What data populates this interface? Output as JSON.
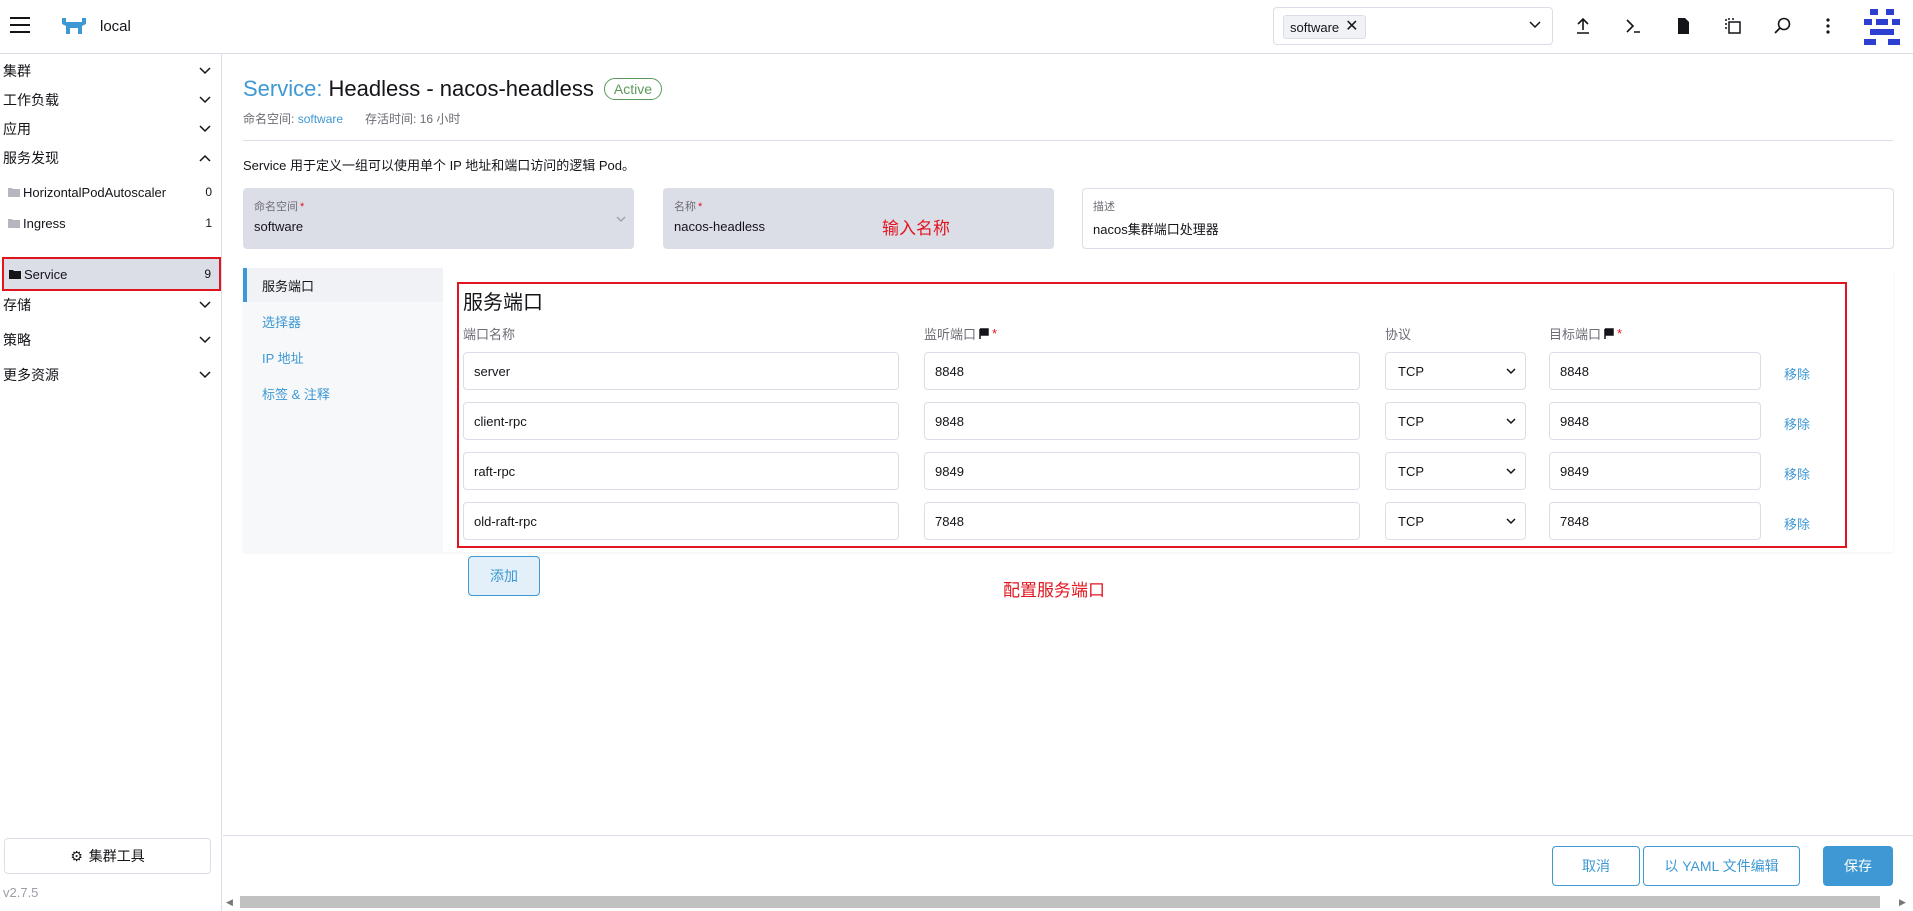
{
  "header": {
    "cluster_name": "local",
    "namespace_filter": {
      "chip": "software"
    },
    "icons": [
      "upload-icon",
      "terminal-icon",
      "file-icon",
      "copy-icon",
      "search-icon",
      "more-icon",
      "user-avatar"
    ]
  },
  "sidebar": {
    "groups": [
      {
        "label": "集群"
      },
      {
        "label": "工作负载"
      },
      {
        "label": "应用"
      },
      {
        "label": "服务发现"
      },
      {
        "label": "存储"
      },
      {
        "label": "策略"
      },
      {
        "label": "更多资源"
      }
    ],
    "service_discovery_items": [
      {
        "label": "HorizontalPodAutoscaler",
        "count": "0"
      },
      {
        "label": "Ingress",
        "count": "1"
      },
      {
        "label": "Service",
        "count": "9"
      }
    ],
    "tools_label": "集群工具",
    "version": "v2.7.5"
  },
  "page": {
    "title_type": "Service:",
    "title_name": "Headless - nacos-headless",
    "status": "Active",
    "namespace_label": "命名空间:",
    "namespace_value": "software",
    "age_label": "存活时间: 16 小时",
    "description": "Service 用于定义一组可以使用单个 IP 地址和端口访问的逻辑 Pod。"
  },
  "form": {
    "namespace": {
      "label": "命名空间",
      "value": "software"
    },
    "name": {
      "label": "名称",
      "value": "nacos-headless"
    },
    "desc": {
      "label": "描述",
      "value": "nacos集群端口处理器"
    },
    "name_annotation": "输入名称"
  },
  "tabs": [
    {
      "label": "服务端口",
      "active": true
    },
    {
      "label": "选择器"
    },
    {
      "label": "IP 地址"
    },
    {
      "label": "标签 & 注释"
    }
  ],
  "ports": {
    "title": "服务端口",
    "headers": {
      "name": "端口名称",
      "listen": "监听端口",
      "protocol": "协议",
      "target": "目标端口"
    },
    "rows": [
      {
        "name": "server",
        "port": "8848",
        "protocol": "TCP",
        "target": "8848"
      },
      {
        "name": "client-rpc",
        "port": "9848",
        "protocol": "TCP",
        "target": "9848"
      },
      {
        "name": "raft-rpc",
        "port": "9849",
        "protocol": "TCP",
        "target": "9849"
      },
      {
        "name": "old-raft-rpc",
        "port": "7848",
        "protocol": "TCP",
        "target": "7848"
      }
    ],
    "remove_label": "移除",
    "add_label": "添加",
    "annotation": "配置服务端口"
  },
  "footer": {
    "cancel": "取消",
    "yaml": "以 YAML 文件编辑",
    "save": "保存"
  },
  "colors": {
    "accent": "#3d98d3",
    "highlight": "#e0151f",
    "success": "#5d995d"
  }
}
